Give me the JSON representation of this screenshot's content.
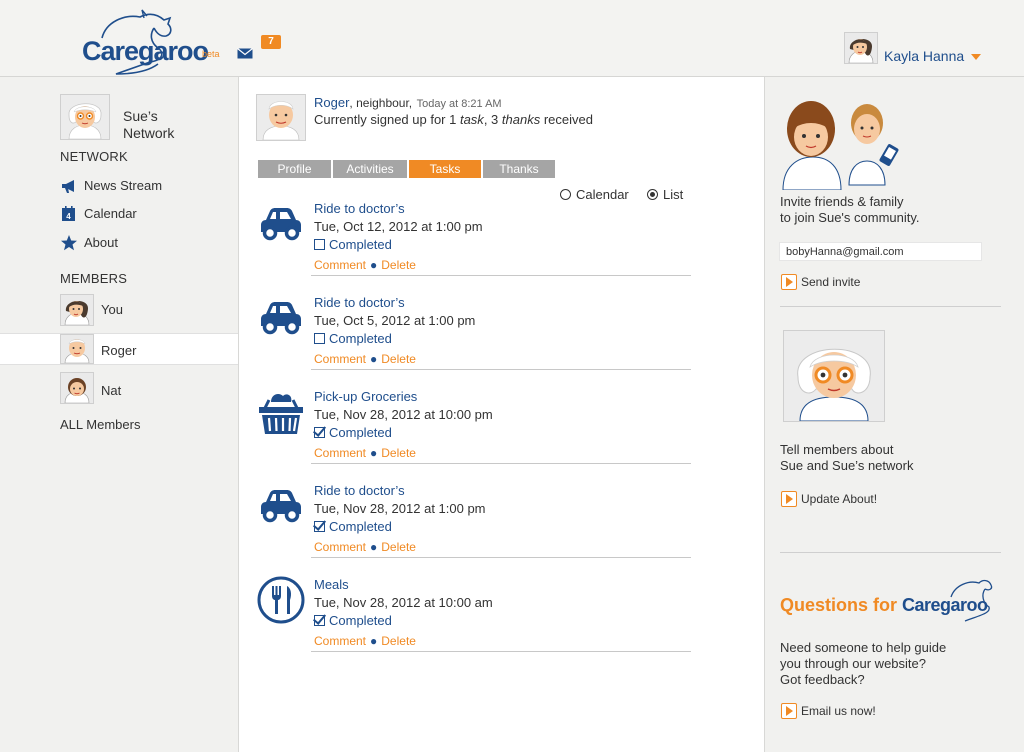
{
  "header": {
    "logo_text": "Caregaroo",
    "logo_badge": "beta",
    "notifications_count": "7",
    "user_name": "Kayla Hanna"
  },
  "sidebar": {
    "network_title": "Sue’s Network",
    "network_heading": "NETWORK",
    "nav": [
      {
        "label": "News Stream",
        "icon": "megaphone-icon"
      },
      {
        "label": "Calendar",
        "icon": "calendar-icon"
      },
      {
        "label": "About",
        "icon": "star-icon"
      }
    ],
    "members_heading": "MEMBERS",
    "members": [
      {
        "label": "You"
      },
      {
        "label": "Roger"
      },
      {
        "label": "Nat"
      }
    ],
    "all_members": "ALL Members"
  },
  "profile": {
    "name": "Roger",
    "relation": ", neighbour,",
    "time": "Today at 8:21 AM",
    "summary_prefix": "Currently signed up for 1 ",
    "summary_task": "task",
    "summary_mid": ", 3 ",
    "summary_thanks": "thanks",
    "summary_suffix": " received"
  },
  "tabs": [
    "Profile",
    "Activities",
    "Tasks",
    "Thanks"
  ],
  "active_tab": "Tasks",
  "view_toggle": {
    "calendar": "Calendar",
    "list": "List",
    "selected": "List"
  },
  "tasks": [
    {
      "title": "Ride to doctor’s",
      "date": "Tue, Oct 12, 2012 at 1:00 pm",
      "status": "Completed",
      "checked": false,
      "icon": "car-icon"
    },
    {
      "title": "Ride to doctor’s",
      "date": "Tue, Oct 5, 2012 at 1:00 pm",
      "status": "Completed",
      "checked": false,
      "icon": "car-icon"
    },
    {
      "title": "Pick-up Groceries",
      "date": "Tue, Nov 28, 2012 at 10:00 pm",
      "status": "Completed",
      "checked": true,
      "icon": "grocery-basket-icon"
    },
    {
      "title": "Ride to doctor’s",
      "date": "Tue, Nov 28, 2012 at 1:00 pm",
      "status": "Completed",
      "checked": true,
      "icon": "car-icon"
    },
    {
      "title": "Meals",
      "date": "Tue, Nov 28,  2012 at 10:00 am",
      "status": "Completed",
      "checked": true,
      "icon": "fork-knife-icon"
    }
  ],
  "task_actions": {
    "comment": "Comment",
    "delete": "Delete"
  },
  "right": {
    "invite_text_1": "Invite friends & family",
    "invite_text_2": "to join Sue's community.",
    "invite_email_value": "bobyHanna@gmail.com",
    "send_invite": "Send invite",
    "tell_text_1": "Tell members about",
    "tell_text_2": "Sue and Sue’s network",
    "update_about": "Update About!",
    "questions_prefix": "Questions for ",
    "questions_brand": "Caregaroo",
    "help_text_1": "Need someone to help guide",
    "help_text_2": "you through our website?",
    "help_text_3": "Got feedback?",
    "email_us": "Email us now!"
  },
  "colors": {
    "brand_blue": "#1f4e8c",
    "accent_orange": "#f08a24",
    "tab_gray": "#a5a5a5"
  }
}
